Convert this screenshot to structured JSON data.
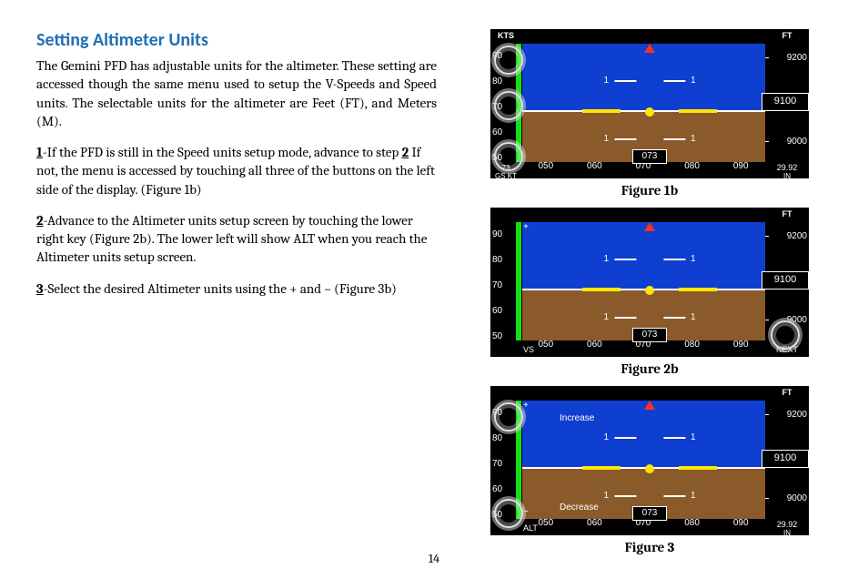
{
  "page_number": "14",
  "title": "Setting Altimeter Units",
  "intro": "The  Gemini  PFD  has  adjustable  units  for  the altimeter.    These  setting  are  accessed  though  the same menu used to setup the V-Speeds and Speed units.    The  selectable  units  for  the  altimeter  are Feet (FT), and Meters (M).",
  "steps": {
    "s1_num": "1",
    "s1": "-If the PFD is still in the Speed units setup mode, advance to step ",
    "s1_ref": "2",
    "s1_tail": " If not, the menu is accessed by touching all three of the buttons on the left side of the display.  (Figure 1b)",
    "s2_num": "2",
    "s2": "-Advance to the Altimeter units setup screen by touching the lower right key (Figure 2b).  The lower left will show ALT when you reach the Altimeter units setup screen.",
    "s3_num": "3",
    "s3": "-Select the desired Altimeter units using the + and – (Figure 3b)"
  },
  "captions": {
    "f1": "Figure 1b",
    "f2": "Figure 2b",
    "f3": "Figure 3"
  },
  "pfd": {
    "spd_label": "KTS",
    "alt_label": "FT",
    "spd_ticks": [
      "90",
      "80",
      "70",
      "60",
      "50"
    ],
    "alt_ticks": [
      "9200",
      "9100",
      "9000"
    ],
    "alt_current": "9100",
    "hdg_ticks": [
      "050",
      "060",
      "070",
      "080",
      "090"
    ],
    "hdg_box": "073",
    "pitch_hi": "1",
    "pitch_lo": "1",
    "fig1_bl1": "73",
    "fig1_bl2": "GS  KT",
    "fig1_br1": "29.92",
    "fig1_br2": "IN",
    "fig2_bl": "VS",
    "fig2_br": "NEXT",
    "fig3_bl": "ALT",
    "fig3_inc": "Increase",
    "fig3_dec": "Decrease",
    "plus": "+",
    "minus": "−"
  }
}
